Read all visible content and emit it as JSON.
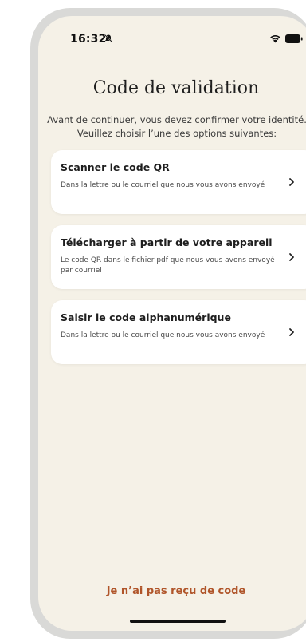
{
  "status_bar": {
    "time": "16:32"
  },
  "screen": {
    "title": "Code de validation",
    "intro_line1": "Avant de continuer, vous devez confirmer votre identité.",
    "intro_line2": "Veuillez choisir l’une des options suivantes:"
  },
  "options": [
    {
      "title": "Scanner le code QR",
      "description": "Dans la lettre ou le courriel que nous vous avons envoyé"
    },
    {
      "title": "Télécharger à partir de votre appareil",
      "description": "Le code QR dans le fichier pdf que nous vous avons envoyé par courriel"
    },
    {
      "title": "Saisir le code alphanumérique",
      "description": "Dans la lettre ou le courriel que nous vous avons envoyé"
    }
  ],
  "footer": {
    "no_code_link": "Je n’ai pas reçu de code"
  },
  "colors": {
    "background": "#f5f1e7",
    "card": "#ffffff",
    "accent": "#b0552a",
    "text": "#1e1e1e"
  }
}
